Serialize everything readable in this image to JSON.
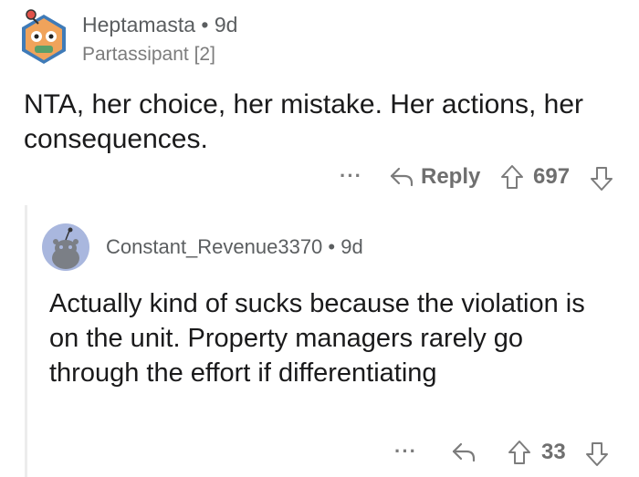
{
  "top_comment": {
    "author": "Heptamasta",
    "separator": "•",
    "age": "9d",
    "flair": "Partassipant [2]",
    "body": "NTA, her choice, her mistake. Her actions, her consequences.",
    "actions": {
      "more_label": "···",
      "reply_label": "Reply",
      "score": "697",
      "reply_icon": "reply-arrow-icon",
      "upvote_icon": "upvote-arrow-icon",
      "downvote_icon": "downvote-arrow-icon"
    }
  },
  "reply_comment": {
    "author": "Constant_Revenue3370",
    "separator": "•",
    "age": "9d",
    "body": "Actually kind of sucks because the violation is on the unit. Property managers rarely go through the effort if differentiating",
    "actions": {
      "more_label": "···",
      "score": "33",
      "reply_icon": "reply-arrow-icon",
      "upvote_icon": "upvote-arrow-icon",
      "downvote_icon": "downvote-arrow-icon"
    }
  },
  "colors": {
    "text": "#1a1a1b",
    "meta": "#7c7c7c",
    "avatar_reply_bg": "#a9b7de",
    "avatar_top_bg": "#f0a35b",
    "thread_line": "#ececec"
  }
}
